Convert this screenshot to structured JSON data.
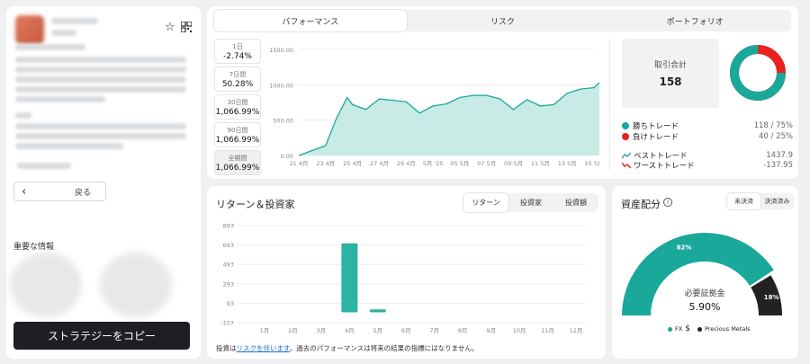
{
  "profile": {
    "back_label": "戻る",
    "important_info": "重要な情報",
    "copy_button": "ストラテジーをコピー"
  },
  "performance": {
    "tabs": [
      {
        "label": "パフォーマンス",
        "active": true
      },
      {
        "label": "リスク",
        "active": false
      },
      {
        "label": "ポートフォリオ",
        "active": false
      }
    ],
    "periods": [
      {
        "label": "1日",
        "value": "-2.74%"
      },
      {
        "label": "7日間",
        "value": "50.28%"
      },
      {
        "label": "30日間",
        "value": "1,066.99%"
      },
      {
        "label": "90日間",
        "value": "1,066.99%"
      },
      {
        "label": "全期間",
        "value": "1,066.99%",
        "active": true
      }
    ],
    "total_trades_label": "取引合計",
    "total_trades_value": "158",
    "winning_label": "勝ちトレード",
    "winning_value": "118 / 75%",
    "losing_label": "負けトレード",
    "losing_value": "40 / 25%",
    "best_label": "ベストトレード",
    "best_value": "1437.9",
    "worst_label": "ワーストトレード",
    "worst_value": "-137.95",
    "win_ratio": 0.75,
    "colors": {
      "win": "#1aa89a",
      "loss": "#e8231f",
      "area": "#bfe8e1",
      "line": "#1aa89a"
    }
  },
  "chart_data": [
    {
      "type": "area",
      "y_ticks": [
        "1500.00",
        "1000.00",
        "500.00",
        "0.00"
      ],
      "ylim": [
        0,
        1500
      ],
      "x_tick_labels": [
        "21 4月",
        "23 4月",
        "25 4月",
        "27 4月",
        "29 4月",
        "5月 '25",
        "05 5月",
        "07 5月",
        "09 5月",
        "11 5月",
        "13 5月",
        "15 5月"
      ],
      "x": [
        0,
        0.5,
        1,
        1.4,
        1.8,
        2,
        2.5,
        3,
        3.5,
        4,
        4.5,
        5,
        5.5,
        6,
        6.5,
        7,
        7.5,
        8,
        8.5,
        9,
        9.5,
        10,
        10.5,
        11,
        11.4,
        11.8
      ],
      "values": [
        0,
        70,
        140,
        520,
        820,
        720,
        650,
        800,
        780,
        760,
        600,
        700,
        730,
        820,
        850,
        850,
        800,
        650,
        790,
        700,
        720,
        880,
        940,
        960,
        1100,
        1120
      ]
    },
    {
      "type": "bar",
      "y_ticks": [
        "893",
        "693",
        "493",
        "293",
        "93",
        "-107"
      ],
      "ylim": [
        -107,
        893
      ],
      "categories": [
        "1月",
        "2月",
        "3月",
        "4月",
        "5月",
        "6月",
        "7月",
        "8月",
        "9月",
        "10月",
        "11月",
        "12月"
      ],
      "values": [
        null,
        null,
        null,
        710,
        30,
        null,
        null,
        null,
        null,
        null,
        null,
        null
      ]
    },
    {
      "type": "pie",
      "categories": [
        "FX",
        "Precious Metals"
      ],
      "values": [
        82,
        18
      ],
      "labels": [
        "82%",
        "18%"
      ]
    }
  ],
  "returns": {
    "title": "リターン＆投資家",
    "segments": [
      {
        "label": "リターン",
        "active": true
      },
      {
        "label": "投資家",
        "active": false
      },
      {
        "label": "投資額",
        "active": false
      }
    ],
    "disclaimer_pre": "投資は",
    "disclaimer_link": "リスクを伴います",
    "disclaimer_post": "。過去のパフォーマンスは将来の結果の指標にはなりません。"
  },
  "allocation": {
    "title": "資産配分",
    "segments": [
      {
        "label": "未決済",
        "active": true
      },
      {
        "label": "決済済み",
        "active": false
      }
    ],
    "margin_label": "必要証拠金",
    "margin_value": "5.90%",
    "fx_symbol": "$",
    "legend": [
      {
        "label": "FX",
        "color": "#1aa89a"
      },
      {
        "label": "Precious Metals",
        "color": "#222"
      }
    ]
  }
}
